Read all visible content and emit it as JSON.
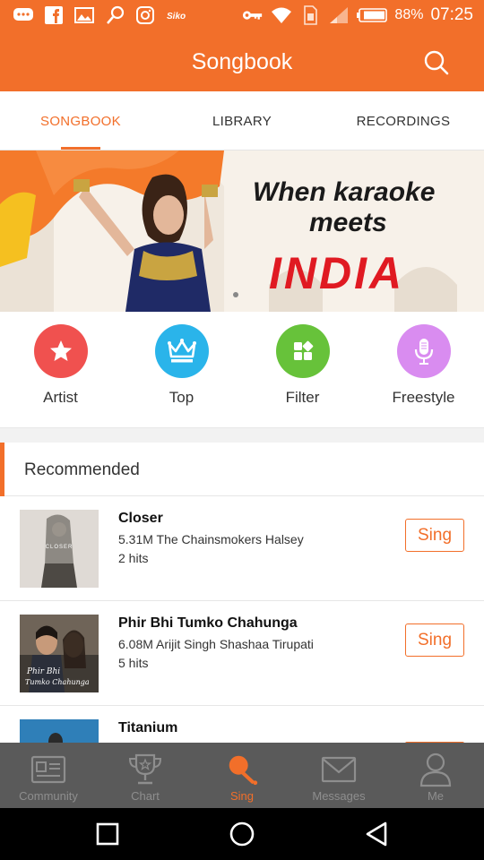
{
  "status_bar": {
    "battery": "88%",
    "time": "07:25",
    "left_icons": [
      "chat-icon",
      "facebook-icon",
      "gallery-icon",
      "pin-icon",
      "instagram-icon",
      "app-icon"
    ],
    "right_icons": [
      "key-icon",
      "wifi-icon",
      "sim-icon",
      "signal-icon",
      "battery-icon"
    ]
  },
  "app_bar": {
    "title": "Songbook",
    "search_icon": "search-icon"
  },
  "tabs": [
    {
      "label": "SONGBOOK",
      "active": true
    },
    {
      "label": "LIBRARY",
      "active": false
    },
    {
      "label": "RECORDINGS",
      "active": false
    }
  ],
  "banner": {
    "line1": "When karaoke",
    "line2": "meets",
    "line3": "INDIA"
  },
  "categories": [
    {
      "label": "Artist",
      "icon": "star-icon",
      "color": "#f0514f"
    },
    {
      "label": "Top",
      "icon": "crown-icon",
      "color": "#2ab4ea"
    },
    {
      "label": "Filter",
      "icon": "grid-icon",
      "color": "#67c23a"
    },
    {
      "label": "Freestyle",
      "icon": "microphone-icon",
      "color": "#d98cf0"
    }
  ],
  "recommended": {
    "title": "Recommended",
    "songs": [
      {
        "title": "Closer",
        "meta": "5.31M  The Chainsmokers Halsey",
        "hits": "2 hits",
        "button": "Sing",
        "thumb_text": "CLOSER"
      },
      {
        "title": "Phir Bhi Tumko Chahunga",
        "meta": "6.08M  Arijit Singh Shashaa Tirupati",
        "hits": "5 hits",
        "button": "Sing",
        "thumb_text": "Phir Bhi Tumko Chahunga"
      },
      {
        "title": "Titanium",
        "meta": "",
        "hits": "",
        "button": "",
        "thumb_text": ""
      }
    ]
  },
  "bottom_nav": [
    {
      "label": "Community",
      "icon": "community-icon",
      "active": false
    },
    {
      "label": "Chart",
      "icon": "trophy-icon",
      "active": false
    },
    {
      "label": "Sing",
      "icon": "sing-microphone-icon",
      "active": true
    },
    {
      "label": "Messages",
      "icon": "mail-icon",
      "active": false
    },
    {
      "label": "Me",
      "icon": "person-icon",
      "active": false
    }
  ],
  "colors": {
    "accent": "#f26f2a",
    "nav_bg": "#5a5a5a"
  }
}
